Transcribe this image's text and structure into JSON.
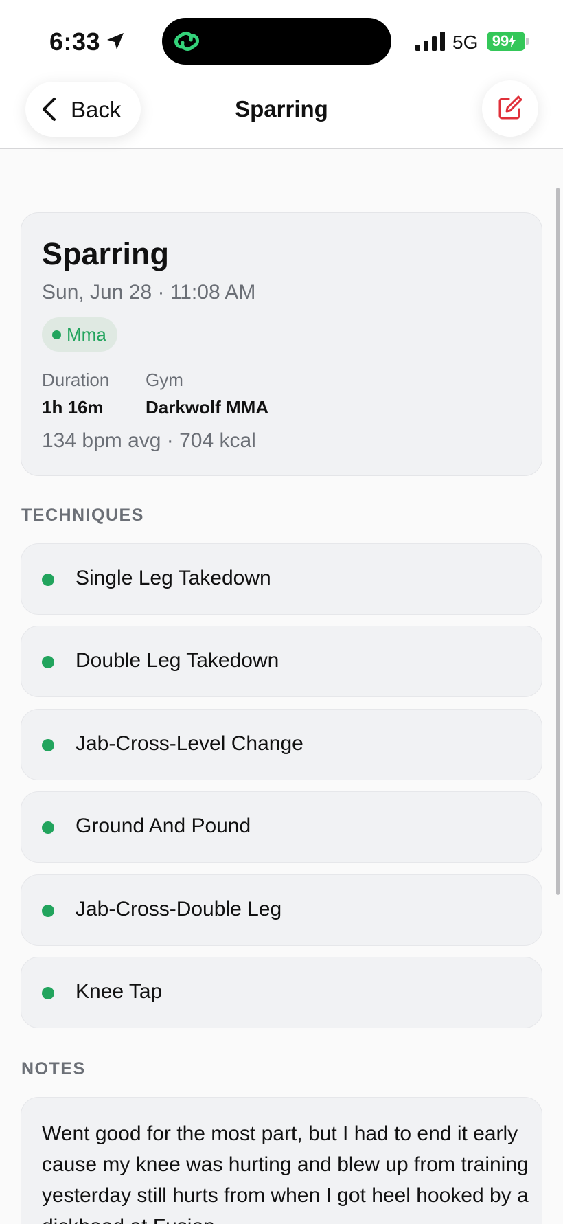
{
  "status_bar": {
    "time": "6:33",
    "network": "5G",
    "battery": "99",
    "location_icon": "location-arrow-icon",
    "island_icon": "app-link-icon",
    "signal_icon": "signal-bars-icon",
    "battery_icon": "battery-charging-icon"
  },
  "nav": {
    "back_label": "Back",
    "title": "Sparring",
    "back_icon": "chevron-left-icon",
    "edit_icon": "edit-icon"
  },
  "session": {
    "title": "Sparring",
    "datetime": "Sun, Jun 28 · 11:08 AM",
    "type_badge": "Mma",
    "duration_label": "Duration",
    "duration_value": "1h 16m",
    "gym_label": "Gym",
    "gym_value": "Darkwolf MMA",
    "metrics": "134 bpm avg · 704 kcal"
  },
  "techniques_header": "TECHNIQUES",
  "techniques": [
    "Single Leg Takedown",
    "Double Leg Takedown",
    "Jab-Cross-Level Change",
    "Ground And Pound",
    "Jab-Cross-Double Leg",
    "Knee Tap"
  ],
  "notes_header": "NOTES",
  "notes": "Went good for the most part, but I had to end it early cause my knee was hurting and blew up from training yesterday still hurts from when I got heel hooked by a dickhead at Fusion",
  "colors": {
    "accent_green": "#22a45d",
    "edit_red": "#e0303a",
    "battery_green": "#34c759",
    "card_bg": "#f1f2f4",
    "muted_text": "#6b6f76"
  }
}
